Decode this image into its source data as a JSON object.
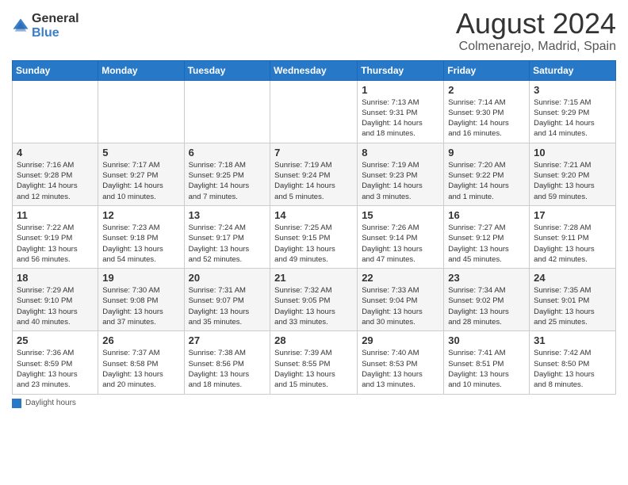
{
  "header": {
    "logo_general": "General",
    "logo_blue": "Blue",
    "month_year": "August 2024",
    "location": "Colmenarejo, Madrid, Spain"
  },
  "days_of_week": [
    "Sunday",
    "Monday",
    "Tuesday",
    "Wednesday",
    "Thursday",
    "Friday",
    "Saturday"
  ],
  "weeks": [
    [
      {
        "day": "",
        "info": ""
      },
      {
        "day": "",
        "info": ""
      },
      {
        "day": "",
        "info": ""
      },
      {
        "day": "",
        "info": ""
      },
      {
        "day": "1",
        "info": "Sunrise: 7:13 AM\nSunset: 9:31 PM\nDaylight: 14 hours\nand 18 minutes."
      },
      {
        "day": "2",
        "info": "Sunrise: 7:14 AM\nSunset: 9:30 PM\nDaylight: 14 hours\nand 16 minutes."
      },
      {
        "day": "3",
        "info": "Sunrise: 7:15 AM\nSunset: 9:29 PM\nDaylight: 14 hours\nand 14 minutes."
      }
    ],
    [
      {
        "day": "4",
        "info": "Sunrise: 7:16 AM\nSunset: 9:28 PM\nDaylight: 14 hours\nand 12 minutes."
      },
      {
        "day": "5",
        "info": "Sunrise: 7:17 AM\nSunset: 9:27 PM\nDaylight: 14 hours\nand 10 minutes."
      },
      {
        "day": "6",
        "info": "Sunrise: 7:18 AM\nSunset: 9:25 PM\nDaylight: 14 hours\nand 7 minutes."
      },
      {
        "day": "7",
        "info": "Sunrise: 7:19 AM\nSunset: 9:24 PM\nDaylight: 14 hours\nand 5 minutes."
      },
      {
        "day": "8",
        "info": "Sunrise: 7:19 AM\nSunset: 9:23 PM\nDaylight: 14 hours\nand 3 minutes."
      },
      {
        "day": "9",
        "info": "Sunrise: 7:20 AM\nSunset: 9:22 PM\nDaylight: 14 hours\nand 1 minute."
      },
      {
        "day": "10",
        "info": "Sunrise: 7:21 AM\nSunset: 9:20 PM\nDaylight: 13 hours\nand 59 minutes."
      }
    ],
    [
      {
        "day": "11",
        "info": "Sunrise: 7:22 AM\nSunset: 9:19 PM\nDaylight: 13 hours\nand 56 minutes."
      },
      {
        "day": "12",
        "info": "Sunrise: 7:23 AM\nSunset: 9:18 PM\nDaylight: 13 hours\nand 54 minutes."
      },
      {
        "day": "13",
        "info": "Sunrise: 7:24 AM\nSunset: 9:17 PM\nDaylight: 13 hours\nand 52 minutes."
      },
      {
        "day": "14",
        "info": "Sunrise: 7:25 AM\nSunset: 9:15 PM\nDaylight: 13 hours\nand 49 minutes."
      },
      {
        "day": "15",
        "info": "Sunrise: 7:26 AM\nSunset: 9:14 PM\nDaylight: 13 hours\nand 47 minutes."
      },
      {
        "day": "16",
        "info": "Sunrise: 7:27 AM\nSunset: 9:12 PM\nDaylight: 13 hours\nand 45 minutes."
      },
      {
        "day": "17",
        "info": "Sunrise: 7:28 AM\nSunset: 9:11 PM\nDaylight: 13 hours\nand 42 minutes."
      }
    ],
    [
      {
        "day": "18",
        "info": "Sunrise: 7:29 AM\nSunset: 9:10 PM\nDaylight: 13 hours\nand 40 minutes."
      },
      {
        "day": "19",
        "info": "Sunrise: 7:30 AM\nSunset: 9:08 PM\nDaylight: 13 hours\nand 37 minutes."
      },
      {
        "day": "20",
        "info": "Sunrise: 7:31 AM\nSunset: 9:07 PM\nDaylight: 13 hours\nand 35 minutes."
      },
      {
        "day": "21",
        "info": "Sunrise: 7:32 AM\nSunset: 9:05 PM\nDaylight: 13 hours\nand 33 minutes."
      },
      {
        "day": "22",
        "info": "Sunrise: 7:33 AM\nSunset: 9:04 PM\nDaylight: 13 hours\nand 30 minutes."
      },
      {
        "day": "23",
        "info": "Sunrise: 7:34 AM\nSunset: 9:02 PM\nDaylight: 13 hours\nand 28 minutes."
      },
      {
        "day": "24",
        "info": "Sunrise: 7:35 AM\nSunset: 9:01 PM\nDaylight: 13 hours\nand 25 minutes."
      }
    ],
    [
      {
        "day": "25",
        "info": "Sunrise: 7:36 AM\nSunset: 8:59 PM\nDaylight: 13 hours\nand 23 minutes."
      },
      {
        "day": "26",
        "info": "Sunrise: 7:37 AM\nSunset: 8:58 PM\nDaylight: 13 hours\nand 20 minutes."
      },
      {
        "day": "27",
        "info": "Sunrise: 7:38 AM\nSunset: 8:56 PM\nDaylight: 13 hours\nand 18 minutes."
      },
      {
        "day": "28",
        "info": "Sunrise: 7:39 AM\nSunset: 8:55 PM\nDaylight: 13 hours\nand 15 minutes."
      },
      {
        "day": "29",
        "info": "Sunrise: 7:40 AM\nSunset: 8:53 PM\nDaylight: 13 hours\nand 13 minutes."
      },
      {
        "day": "30",
        "info": "Sunrise: 7:41 AM\nSunset: 8:51 PM\nDaylight: 13 hours\nand 10 minutes."
      },
      {
        "day": "31",
        "info": "Sunrise: 7:42 AM\nSunset: 8:50 PM\nDaylight: 13 hours\nand 8 minutes."
      }
    ]
  ],
  "footer": {
    "daylight_label": "Daylight hours"
  }
}
